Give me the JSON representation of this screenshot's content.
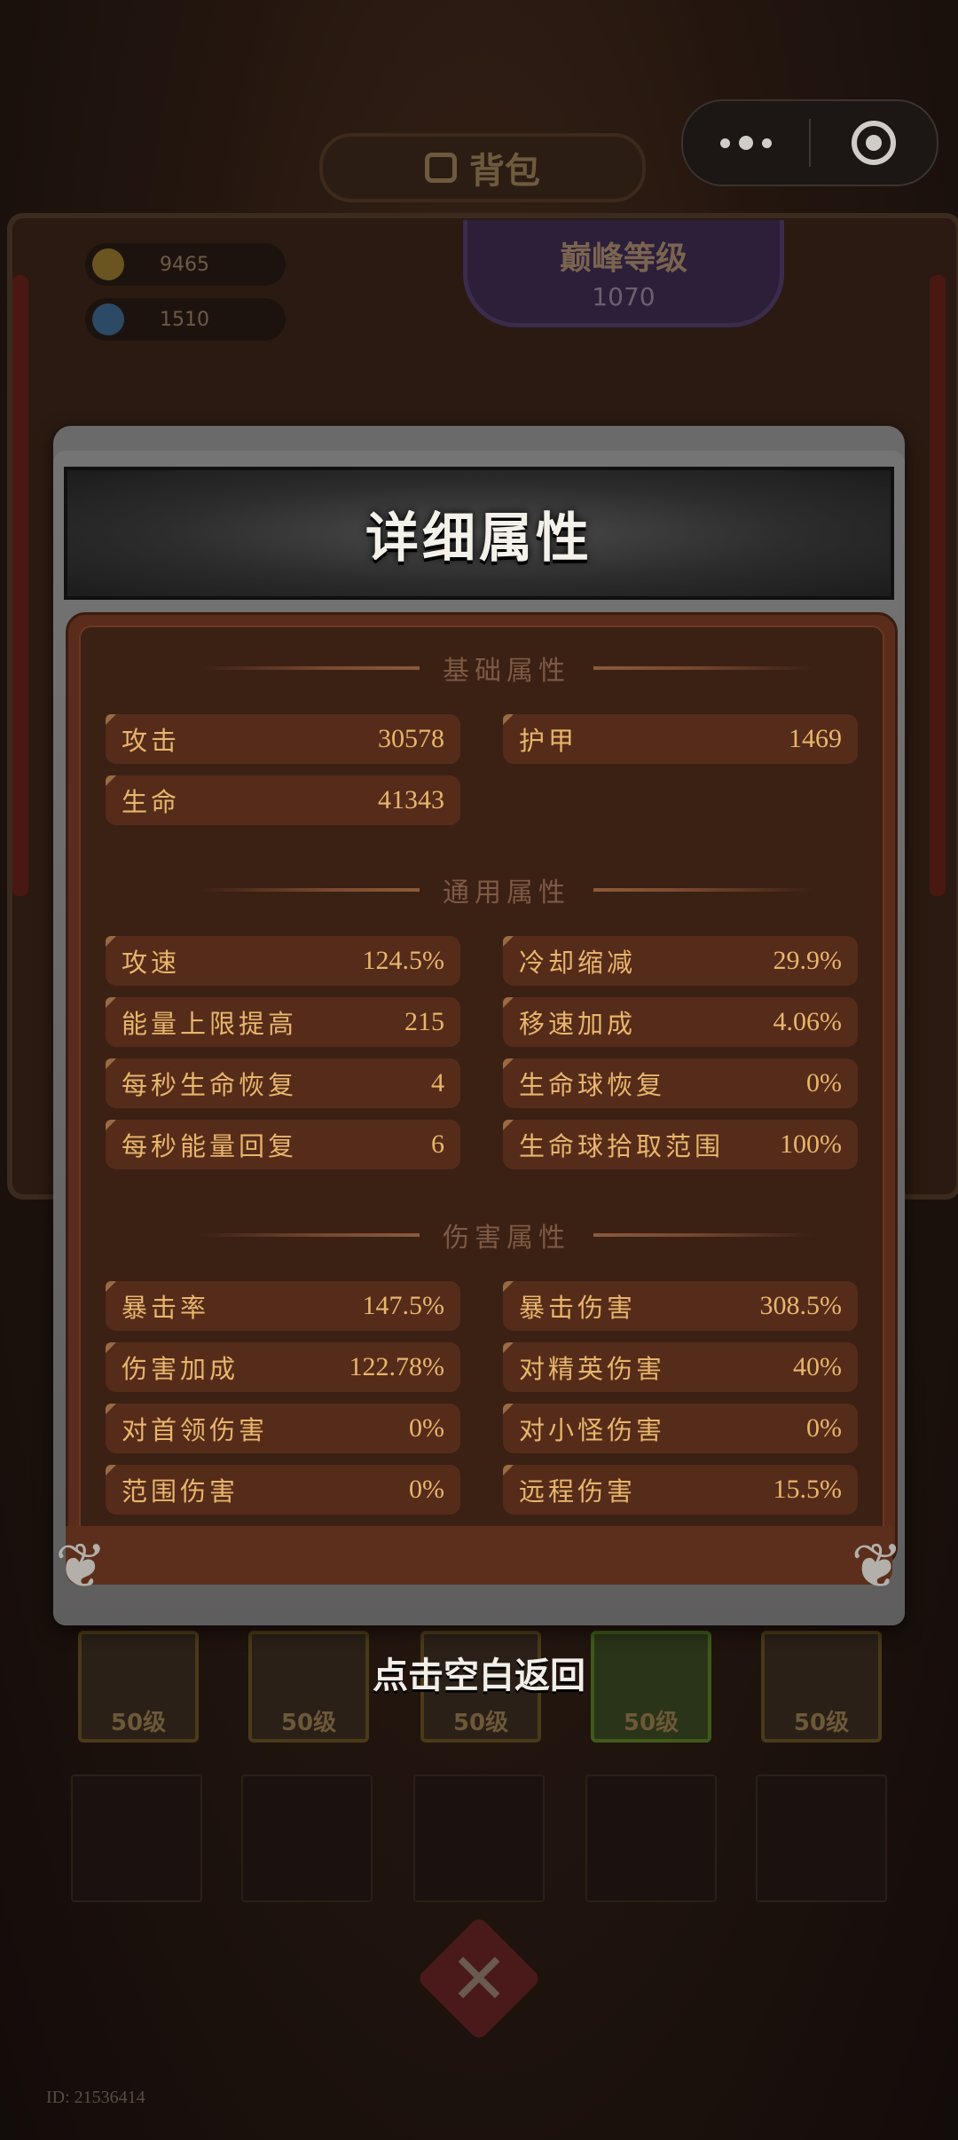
{
  "background": {
    "bag_title": "背包",
    "currencies": [
      {
        "value": "9465",
        "icon": "gold-coin-icon"
      },
      {
        "value": "1510",
        "icon": "gem-icon"
      }
    ],
    "peak_level": {
      "title": "巅峰等级",
      "value": "1070"
    },
    "equipment_slots": [
      {
        "label": "50级",
        "icon": "crown-icon"
      },
      {
        "label": "50级",
        "icon": "ring-icon"
      },
      {
        "label": "50级",
        "icon": "armor-icon"
      },
      {
        "label": "50级",
        "icon": "gauntlet-icon"
      },
      {
        "label": "50级",
        "icon": "pants-icon"
      }
    ],
    "player_id": "ID: 21536414"
  },
  "popup": {
    "title": "详细属性",
    "sections": [
      {
        "heading": "基础属性",
        "stats": [
          {
            "name": "攻击",
            "value": "30578"
          },
          {
            "name": "护甲",
            "value": "1469"
          },
          {
            "name": "生命",
            "value": "41343"
          }
        ]
      },
      {
        "heading": "通用属性",
        "stats": [
          {
            "name": "攻速",
            "value": "124.5%"
          },
          {
            "name": "冷却缩减",
            "value": "29.9%"
          },
          {
            "name": "能量上限提高",
            "value": "215"
          },
          {
            "name": "移速加成",
            "value": "4.06%"
          },
          {
            "name": "每秒生命恢复",
            "value": "4"
          },
          {
            "name": "生命球恢复",
            "value": "0%"
          },
          {
            "name": "每秒能量回复",
            "value": "6"
          },
          {
            "name": "生命球拾取范围",
            "value": "100%"
          }
        ]
      },
      {
        "heading": "伤害属性",
        "stats": [
          {
            "name": "暴击率",
            "value": "147.5%"
          },
          {
            "name": "暴击伤害",
            "value": "308.5%"
          },
          {
            "name": "伤害加成",
            "value": "122.78%"
          },
          {
            "name": "对精英伤害",
            "value": "40%"
          },
          {
            "name": "对首领伤害",
            "value": "0%"
          },
          {
            "name": "对小怪伤害",
            "value": "0%"
          },
          {
            "name": "范围伤害",
            "value": "0%"
          },
          {
            "name": "远程伤害",
            "value": "15.5%"
          }
        ]
      }
    ],
    "dismiss_hint": "点击空白返回"
  },
  "capsule": {
    "more_icon": "more-dots-icon",
    "close_icon": "close-circle-icon"
  }
}
